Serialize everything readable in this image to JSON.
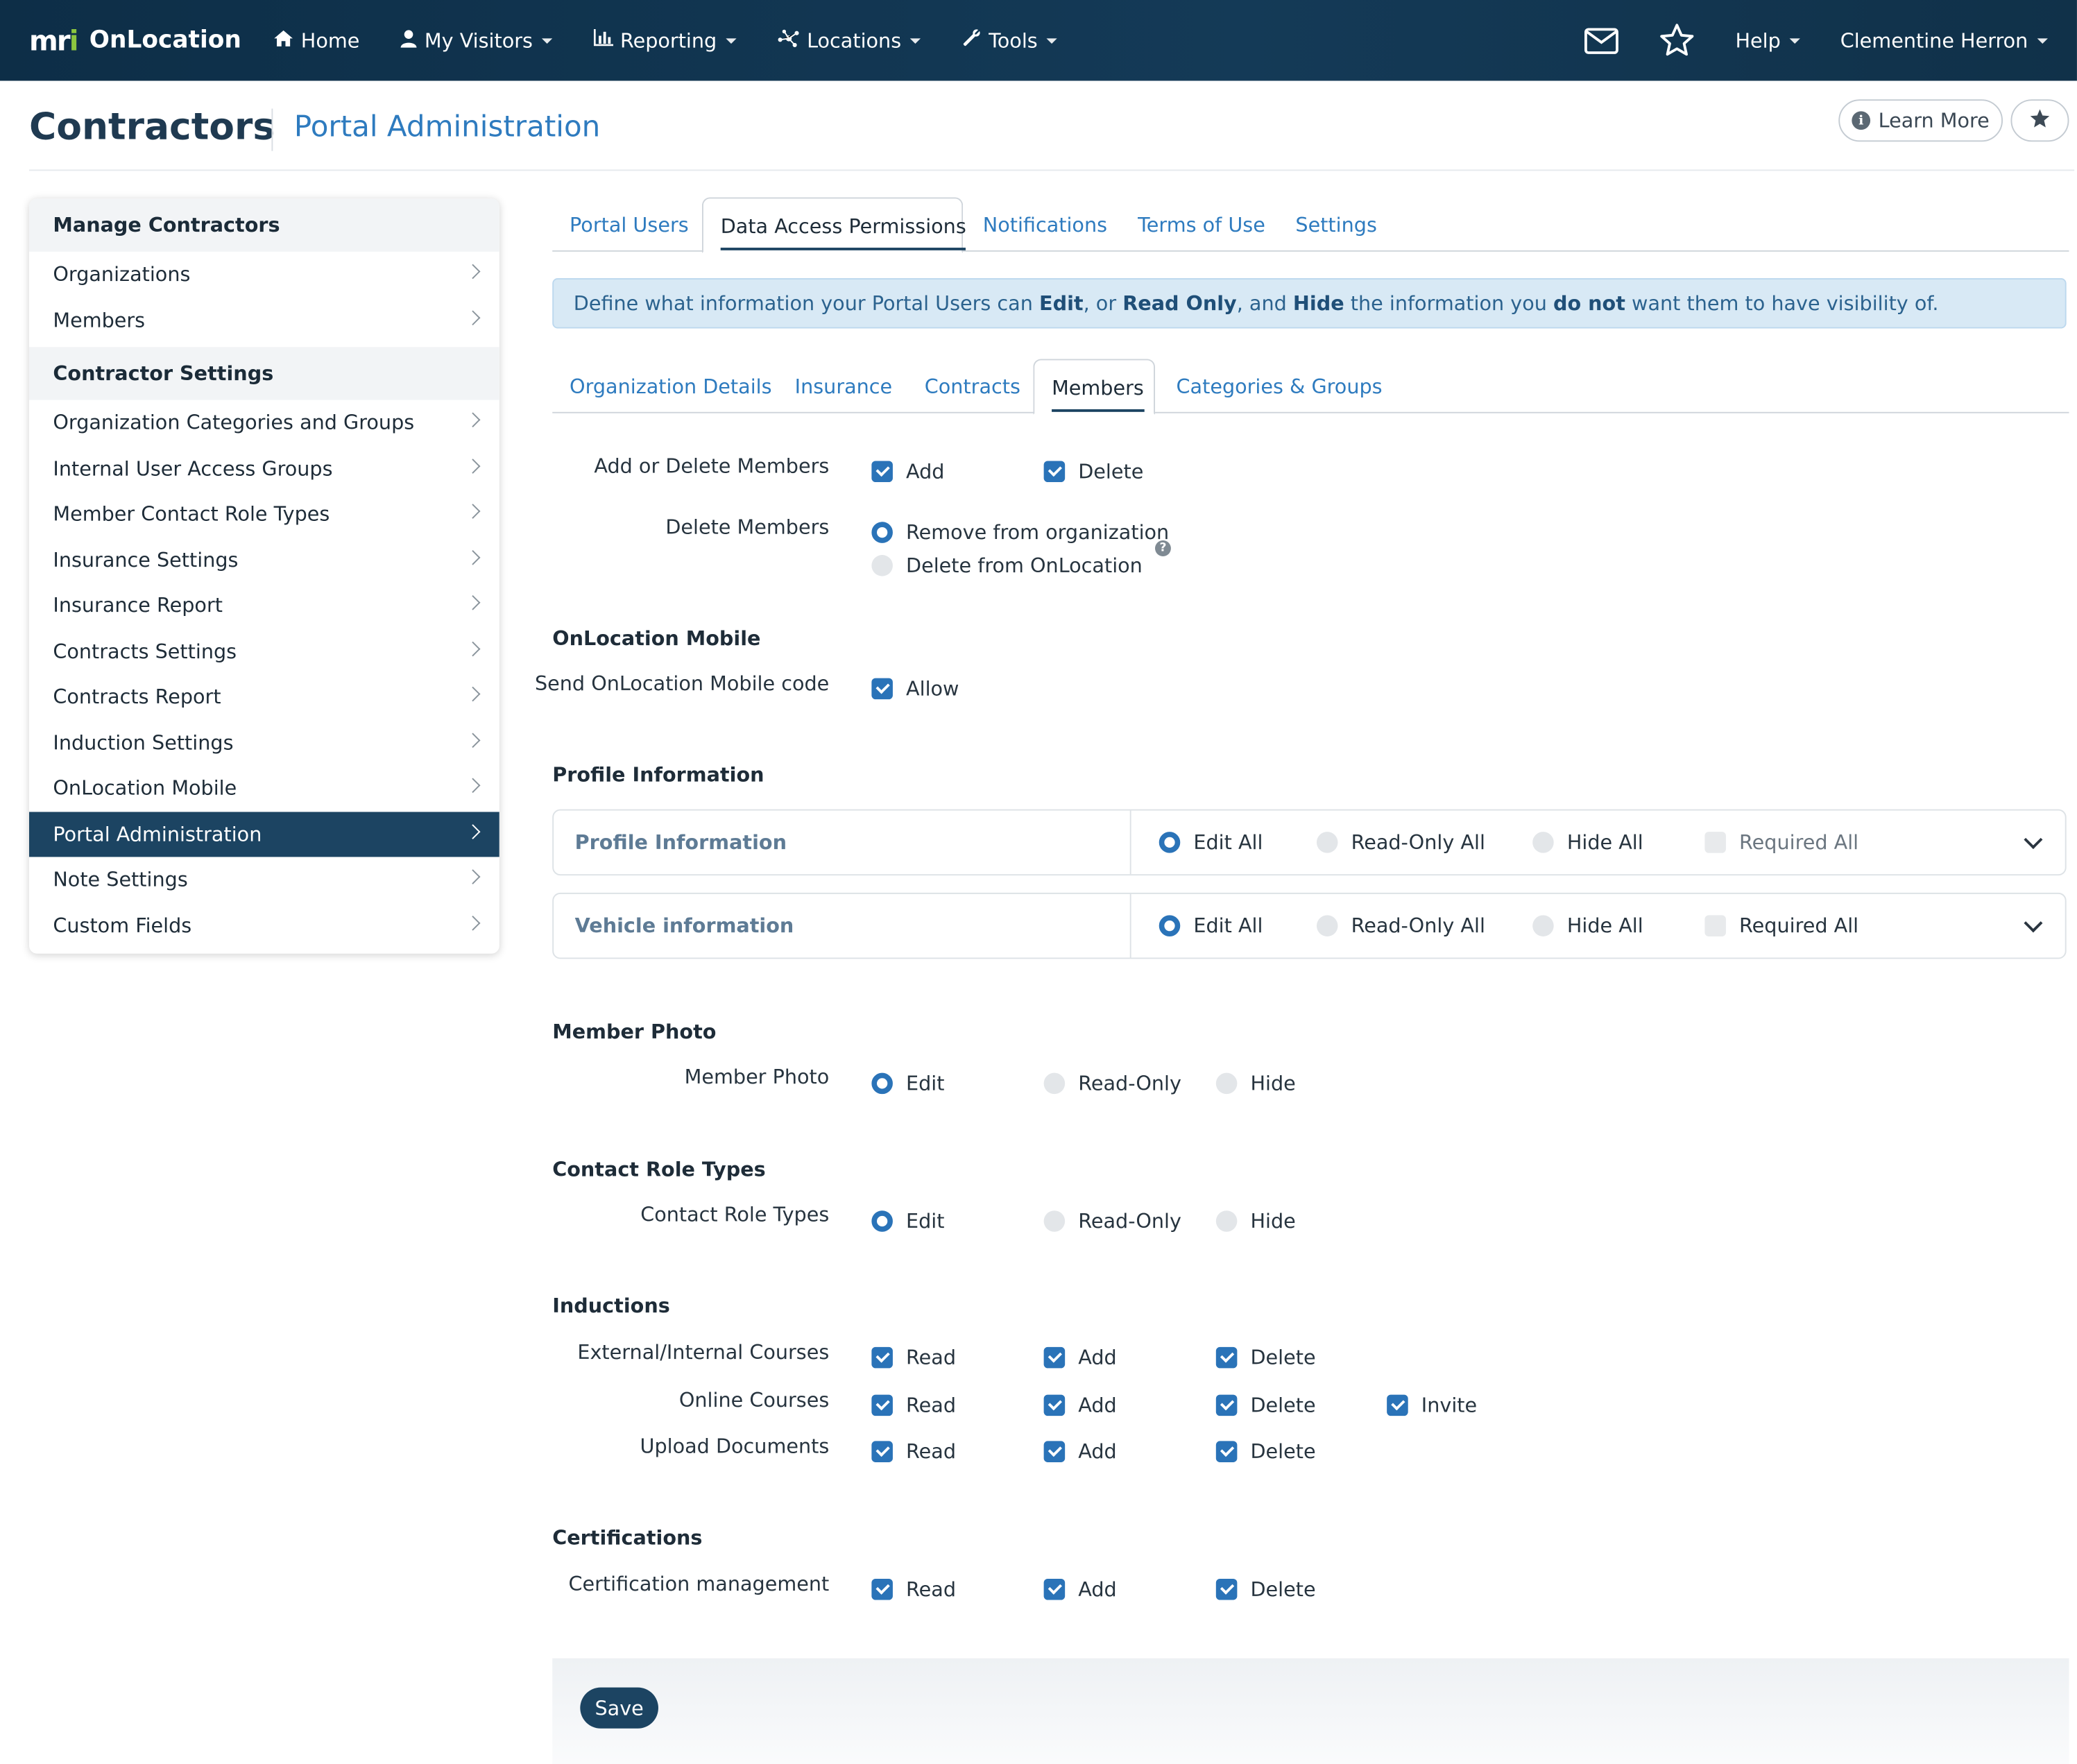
{
  "nav": {
    "brand_mark_a": "m",
    "brand_mark_b": "r",
    "brand_mark_c": "i",
    "brand_name": "OnLocation",
    "items": [
      "Home",
      "My Visitors",
      "Reporting",
      "Locations",
      "Tools"
    ],
    "help": "Help",
    "user": "Clementine Herron"
  },
  "header": {
    "title": "Contractors",
    "subtitle": "Portal Administration",
    "learn_more": "Learn More"
  },
  "sidebar": {
    "section1": "Manage Contractors",
    "section1_items": [
      "Organizations",
      "Members"
    ],
    "section2": "Contractor Settings",
    "section2_items": [
      "Organization Categories and Groups",
      "Internal User Access Groups",
      "Member Contact Role Types",
      "Insurance Settings",
      "Insurance Report",
      "Contracts Settings",
      "Contracts Report",
      "Induction Settings",
      "OnLocation Mobile",
      "Portal Administration",
      "Note Settings",
      "Custom Fields"
    ]
  },
  "tabs": [
    "Portal Users",
    "Data Access Permissions",
    "Notifications",
    "Terms of Use",
    "Settings"
  ],
  "info": {
    "t1": "Define what information your Portal Users can ",
    "b1": "Edit",
    "t2": ", or ",
    "b2": "Read Only",
    "t3": ", and ",
    "b3": "Hide",
    "t4": " the information you ",
    "b4": "do not",
    "t5": " want them to have visibility of."
  },
  "subtabs": [
    "Organization Details",
    "Insurance",
    "Contracts",
    "Members",
    "Categories & Groups"
  ],
  "members": {
    "add_delete_label": "Add or Delete Members",
    "add": "Add",
    "delete": "Delete",
    "delete_members_label": "Delete Members",
    "remove_org": "Remove from organization",
    "delete_onlocation": "Delete from OnLocation"
  },
  "mobile": {
    "title": "OnLocation Mobile",
    "label": "Send OnLocation Mobile code",
    "allow": "Allow"
  },
  "profile": {
    "title": "Profile Information",
    "panels": [
      "Profile Information",
      "Vehicle information"
    ],
    "edit_all": "Edit All",
    "read_only_all": "Read-Only All",
    "hide_all": "Hide All",
    "required_all": "Required All"
  },
  "photo": {
    "title": "Member Photo",
    "label": "Member Photo"
  },
  "roles": {
    "title": "Contact Role Types",
    "label": "Contact Role Types"
  },
  "opts": {
    "edit": "Edit",
    "read_only": "Read-Only",
    "hide": "Hide",
    "read": "Read",
    "add": "Add",
    "delete": "Delete",
    "invite": "Invite"
  },
  "inductions": {
    "title": "Inductions",
    "rows": [
      "External/Internal Courses",
      "Online Courses",
      "Upload Documents"
    ]
  },
  "certifications": {
    "title": "Certifications",
    "label": "Certification management"
  },
  "save": "Save",
  "colors": {
    "nav": "#143a57",
    "accent": "#2a73b8",
    "link": "#2e7bbf",
    "active": "#1c4462",
    "info_bg": "#d8e9f5"
  }
}
